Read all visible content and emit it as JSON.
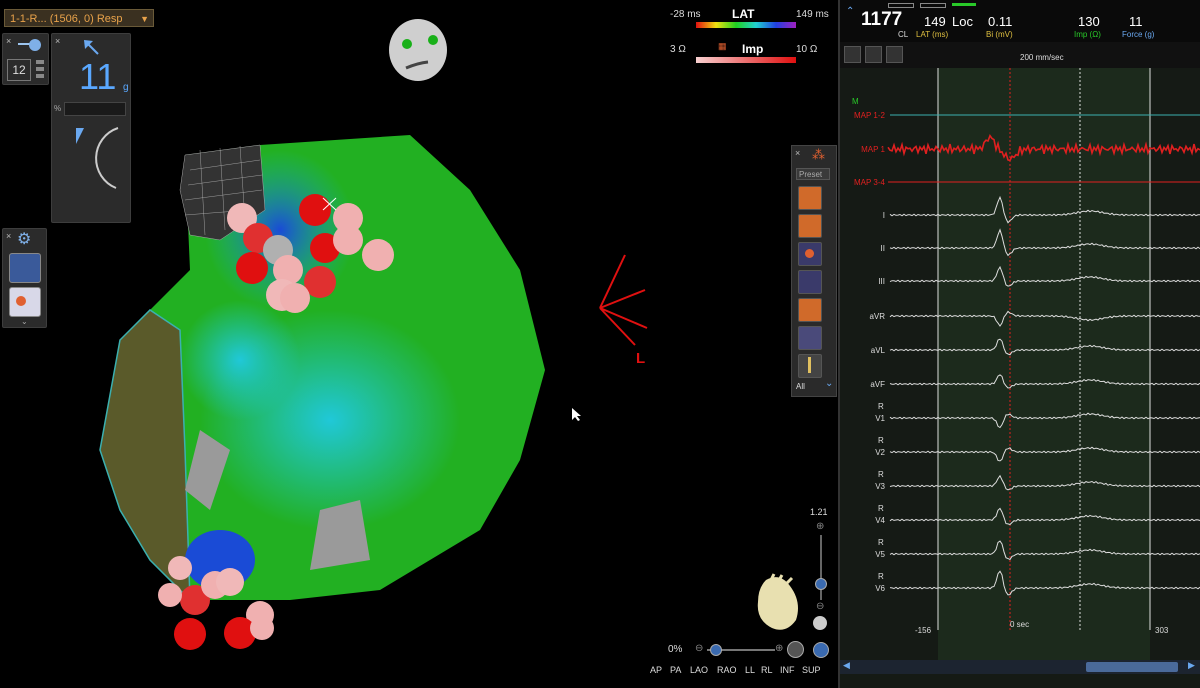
{
  "map_selector": {
    "label": "1-1-R... (1506, 0) Resp"
  },
  "contact_widget": {
    "count": "12",
    "force_value": "11",
    "force_unit": "g",
    "percent_label": "%"
  },
  "lat_legend": {
    "min": "-28 ms",
    "title": "LAT",
    "max": "149 ms"
  },
  "imp_legend": {
    "min": "3 Ω",
    "title": "Imp",
    "max": "10 Ω"
  },
  "orientation": {
    "label": "L"
  },
  "tool_strip": {
    "preset_label": "Preset",
    "all_label": "All"
  },
  "zoom": {
    "value": "1.21",
    "percent": "0%"
  },
  "view_buttons": [
    "AP",
    "PA",
    "LAO",
    "RAO",
    "LL",
    "RL",
    "INF",
    "SUP"
  ],
  "ecg_header": {
    "cl_value": "1177",
    "cl_label": "CL",
    "lat_value": "149",
    "lat_label": "LAT (ms)",
    "loc_label": "Loc",
    "bi_value": "0.11",
    "bi_label": "Bi (mV)",
    "imp_value": "130",
    "imp_label": "Imp (Ω)",
    "force_value": "11",
    "force_label": "Force (g)"
  },
  "ecg": {
    "speed": "200 mm/sec",
    "time_left": "-156",
    "time_center": "0 sec",
    "time_right": "303",
    "marker_label": "M",
    "channels": [
      {
        "name": "MAP 1-2",
        "color": "#e02020"
      },
      {
        "name": "MAP 1",
        "color": "#e02020"
      },
      {
        "name": "MAP 3-4",
        "color": "#e02020"
      },
      {
        "name": "I",
        "color": "#dddddd"
      },
      {
        "name": "II",
        "color": "#dddddd"
      },
      {
        "name": "III",
        "color": "#dddddd"
      },
      {
        "name": "aVR",
        "color": "#dddddd"
      },
      {
        "name": "aVL",
        "color": "#dddddd"
      },
      {
        "name": "aVF",
        "color": "#dddddd"
      },
      {
        "name": "V1",
        "color": "#dddddd"
      },
      {
        "name": "V2",
        "color": "#dddddd"
      },
      {
        "name": "V3",
        "color": "#dddddd"
      },
      {
        "name": "V4",
        "color": "#dddddd"
      },
      {
        "name": "V5",
        "color": "#dddddd"
      },
      {
        "name": "V6",
        "color": "#dddddd"
      }
    ],
    "r_label": "R"
  },
  "colors": {
    "accent": "#e8a24a",
    "marker_green": "#29c929",
    "trace_red": "#e02020",
    "teal_line": "#3bb0b0",
    "force_blue": "#5aa8ff"
  }
}
